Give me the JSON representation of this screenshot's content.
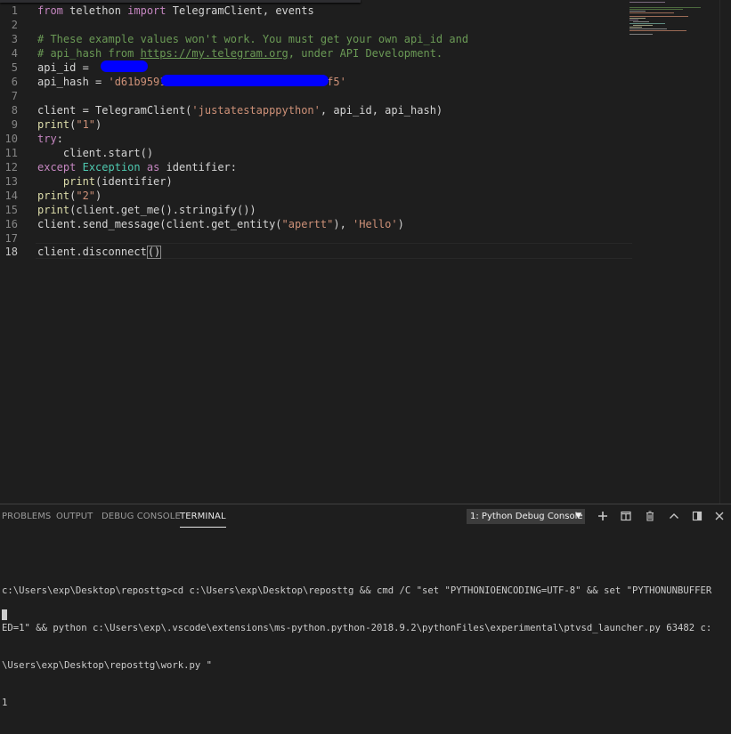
{
  "editor": {
    "lines": [
      {
        "n": "1",
        "tokens": [
          {
            "t": "kw",
            "v": "from"
          },
          {
            "t": "",
            "v": " telethon "
          },
          {
            "t": "kw",
            "v": "import"
          },
          {
            "t": "",
            "v": " TelegramClient, events"
          }
        ]
      },
      {
        "n": "2",
        "tokens": []
      },
      {
        "n": "3",
        "tokens": [
          {
            "t": "cm",
            "v": "# These example values won't work. You must get your own api_id and"
          }
        ]
      },
      {
        "n": "4",
        "tokens": [
          {
            "t": "cm",
            "v": "# api_hash from "
          },
          {
            "t": "lnk",
            "v": "https://my.telegram.org"
          },
          {
            "t": "cm",
            "v": ", under API Development."
          }
        ]
      },
      {
        "n": "5",
        "tokens": [
          {
            "t": "",
            "v": "api_id = "
          }
        ]
      },
      {
        "n": "6",
        "tokens": [
          {
            "t": "",
            "v": "api_hash = "
          },
          {
            "t": "str",
            "v": "'d61b9591"
          },
          {
            "t": "gap",
            "v": "                   "
          },
          {
            "t": "str",
            "v": "71eca4f5'"
          }
        ]
      },
      {
        "n": "7",
        "tokens": []
      },
      {
        "n": "8",
        "tokens": [
          {
            "t": "",
            "v": "client = TelegramClient("
          },
          {
            "t": "str",
            "v": "'justatestapppython'"
          },
          {
            "t": "",
            "v": ", api_id, api_hash)"
          }
        ]
      },
      {
        "n": "9",
        "tokens": [
          {
            "t": "fn",
            "v": "print"
          },
          {
            "t": "",
            "v": "("
          },
          {
            "t": "str",
            "v": "\"1\""
          },
          {
            "t": "",
            "v": ")"
          }
        ]
      },
      {
        "n": "10",
        "tokens": [
          {
            "t": "kw",
            "v": "try"
          },
          {
            "t": "",
            "v": ":"
          }
        ]
      },
      {
        "n": "11",
        "tokens": [
          {
            "t": "",
            "v": "    client.start()"
          }
        ]
      },
      {
        "n": "12",
        "tokens": [
          {
            "t": "kw",
            "v": "except"
          },
          {
            "t": "",
            "v": " "
          },
          {
            "t": "cls",
            "v": "Exception"
          },
          {
            "t": "",
            "v": " "
          },
          {
            "t": "kw",
            "v": "as"
          },
          {
            "t": "",
            "v": " identifier:"
          }
        ]
      },
      {
        "n": "13",
        "tokens": [
          {
            "t": "",
            "v": "    "
          },
          {
            "t": "fn",
            "v": "print"
          },
          {
            "t": "",
            "v": "(identifier)"
          }
        ]
      },
      {
        "n": "14",
        "tokens": [
          {
            "t": "fn",
            "v": "print"
          },
          {
            "t": "",
            "v": "("
          },
          {
            "t": "str",
            "v": "\"2\""
          },
          {
            "t": "",
            "v": ")"
          }
        ]
      },
      {
        "n": "15",
        "tokens": [
          {
            "t": "fn",
            "v": "print"
          },
          {
            "t": "",
            "v": "(client.get_me().stringify())"
          }
        ]
      },
      {
        "n": "16",
        "tokens": [
          {
            "t": "",
            "v": "client.send_message(client.get_entity("
          },
          {
            "t": "str",
            "v": "\"apertt\""
          },
          {
            "t": "",
            "v": "), "
          },
          {
            "t": "str",
            "v": "'Hello'"
          },
          {
            "t": "",
            "v": ")"
          }
        ]
      },
      {
        "n": "17",
        "tokens": []
      },
      {
        "n": "18",
        "tokens": [
          {
            "t": "",
            "v": "client.disconnect"
          },
          {
            "t": "box",
            "v": "()"
          }
        ]
      }
    ],
    "active_line": "18"
  },
  "panel": {
    "tabs": [
      {
        "id": "problems",
        "label": "PROBLEMS",
        "active": false
      },
      {
        "id": "output",
        "label": "OUTPUT",
        "active": false
      },
      {
        "id": "debug-console",
        "label": "DEBUG CONSOLE",
        "active": false
      },
      {
        "id": "terminal",
        "label": "TERMINAL",
        "active": true
      }
    ],
    "terminal_selector": "1: Python Debug Console",
    "icons": [
      "plus-icon",
      "split-icon",
      "trash-icon",
      "chevron-up-icon",
      "maximize-icon",
      "close-icon"
    ],
    "terminal_lines": [
      "c:\\Users\\exp\\Desktop\\reposttg>cd c:\\Users\\exp\\Desktop\\reposttg && cmd /C \"set \"PYTHONIOENCODING=UTF-8\" && set \"PYTHONUNBUFFER",
      "ED=1\" && python c:\\Users\\exp\\.vscode\\extensions\\ms-python.python-2018.9.2\\pythonFiles\\experimental\\ptvsd_launcher.py 63482 c:",
      "\\Users\\exp\\Desktop\\reposttg\\work.py \"",
      "1"
    ]
  },
  "colors": {
    "background": "#1e1e1e",
    "keyword": "#c586c0",
    "comment": "#6a9955",
    "string": "#ce9178",
    "class": "#4ec9b0",
    "function": "#dcdcaa",
    "redaction": "#0000ff"
  }
}
